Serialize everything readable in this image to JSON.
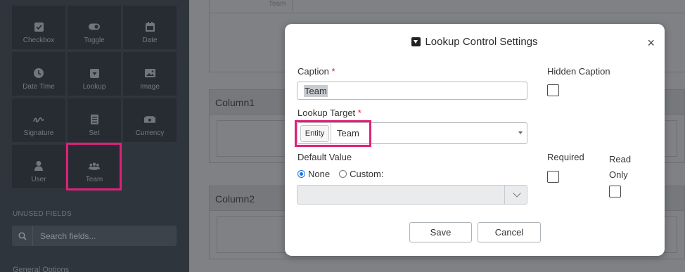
{
  "sidebar": {
    "tiles": [
      {
        "label": "Checkbox",
        "icon": "checkbox-icon"
      },
      {
        "label": "Toggle",
        "icon": "toggle-icon"
      },
      {
        "label": "Date",
        "icon": "calendar-icon"
      },
      {
        "label": "Date Time",
        "icon": "clock-icon"
      },
      {
        "label": "Lookup",
        "icon": "lookup-icon"
      },
      {
        "label": "Image",
        "icon": "image-icon"
      },
      {
        "label": "Signature",
        "icon": "signature-icon"
      },
      {
        "label": "Set",
        "icon": "set-icon"
      },
      {
        "label": "Currency",
        "icon": "currency-icon"
      },
      {
        "label": "User",
        "icon": "user-icon"
      },
      {
        "label": "Team",
        "icon": "team-icon"
      }
    ],
    "unused_fields_title": "UNUSED FIELDS",
    "search_placeholder": "Search fields...",
    "general_options": "General Options"
  },
  "canvas": {
    "team_label": "Team",
    "column1": "Column1",
    "column2": "Column2"
  },
  "modal": {
    "title": "Lookup Control Settings",
    "close": "×",
    "caption_label": "Caption",
    "required_mark": "*",
    "caption_value": "Team",
    "hidden_caption_label": "Hidden Caption",
    "lookup_target_label": "Lookup Target",
    "entity_label": "Entity",
    "lookup_target_value": "Team",
    "default_value_label": "Default Value",
    "none_label": "None",
    "custom_label": "Custom:",
    "required_label": "Required",
    "read_only_label": "Read\nOnly",
    "save_label": "Save",
    "cancel_label": "Cancel"
  },
  "colors": {
    "highlight": "#e0207a",
    "sidebar_bg": "#2f353d",
    "radio_selected": "#1a73e8"
  }
}
